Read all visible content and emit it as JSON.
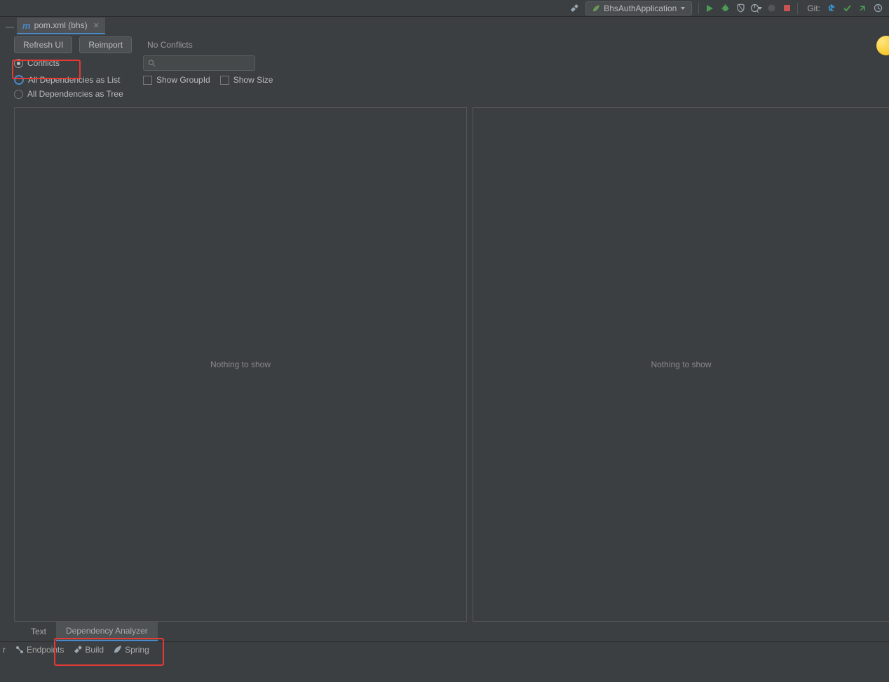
{
  "toolbar": {
    "runConfig": "BhsAuthApplication",
    "gitLabel": "Git:"
  },
  "tab": {
    "fileName": "pom.xml (bhs)"
  },
  "actions": {
    "refresh": "Refresh UI",
    "reimport": "Reimport",
    "status": "No Conflicts"
  },
  "radios": {
    "conflicts": "Conflicts",
    "asList": "All Dependencies as List",
    "asTree": "All Dependencies as Tree"
  },
  "checkboxes": {
    "showGroupId": "Show GroupId",
    "showSize": "Show Size"
  },
  "panels": {
    "leftEmpty": "Nothing to show",
    "rightEmpty": "Nothing to show"
  },
  "bottomTabs": {
    "text": "Text",
    "analyzer": "Dependency Analyzer"
  },
  "statusBar": {
    "item0": "r",
    "endpoints": "Endpoints",
    "build": "Build",
    "spring": "Spring"
  }
}
